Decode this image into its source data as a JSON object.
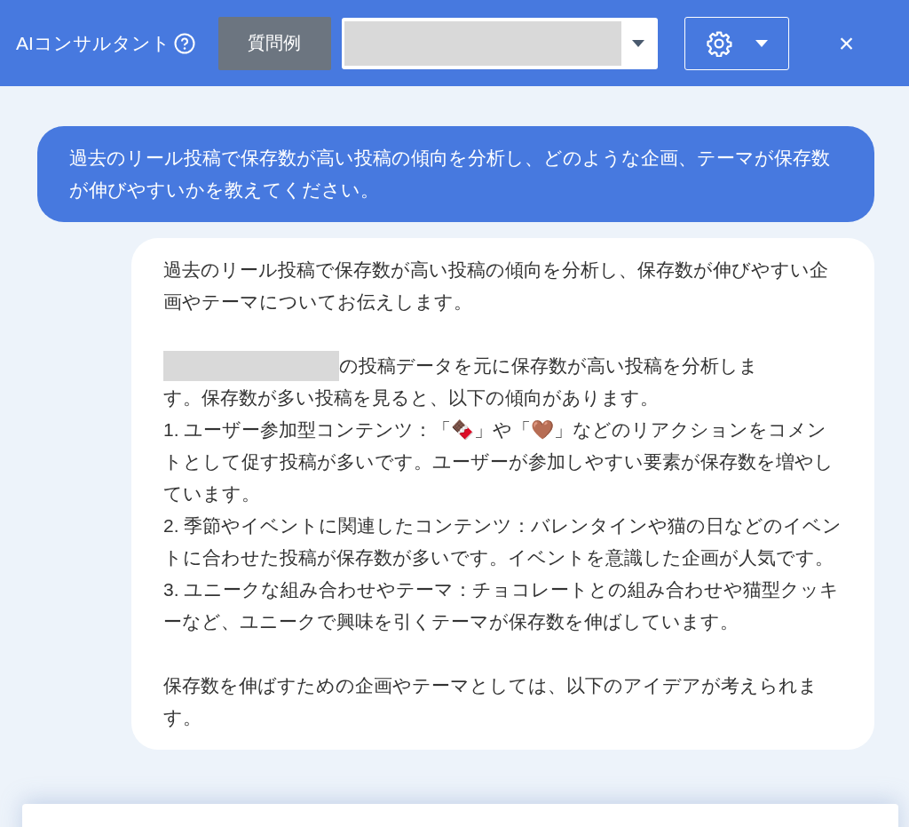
{
  "header": {
    "title": "AIコンサルタント",
    "examples_button": "質問例",
    "close": "×"
  },
  "messages": [
    {
      "kind": "user",
      "paragraphs": [
        {
          "kind": "text",
          "text": "過去のリール投稿で保存数が高い投稿の傾向を分析し、どのような企画、テーマが保存数が伸びやすいかを教えてください。"
        }
      ]
    },
    {
      "kind": "assistant",
      "paragraphs": [
        {
          "kind": "text",
          "text": "過去のリール投稿で保存数が高い投稿の傾向を分析し、保存数が伸びやすい企画やテーマについてお伝えします。"
        },
        {
          "kind": "spacer"
        },
        {
          "kind": "redacted_lead",
          "text": "の投稿データを元に保存数が高い投稿を分析しま",
          "continuation": "す。保存数が多い投稿を見ると、以下の傾向があります。"
        },
        {
          "kind": "text",
          "text": "1. ユーザー参加型コンテンツ：「🍫」や「🤎」などのリアクションをコメントとして促す投稿が多いです。ユーザーが参加しやすい要素が保存数を増やしています。"
        },
        {
          "kind": "text",
          "text": "2. 季節やイベントに関連したコンテンツ：バレンタインや猫の日などのイベントに合わせた投稿が保存数が多いです。イベントを意識した企画が人気です。"
        },
        {
          "kind": "text",
          "text": "3. ユニークな組み合わせやテーマ：チョコレートとの組み合わせや猫型クッキーなど、ユニークで興味を引くテーマが保存数を伸ばしています。"
        },
        {
          "kind": "spacer"
        },
        {
          "kind": "text",
          "text": "保存数を伸ばすための企画やテーマとしては、以下のアイデアが考えられます。"
        }
      ]
    }
  ]
}
